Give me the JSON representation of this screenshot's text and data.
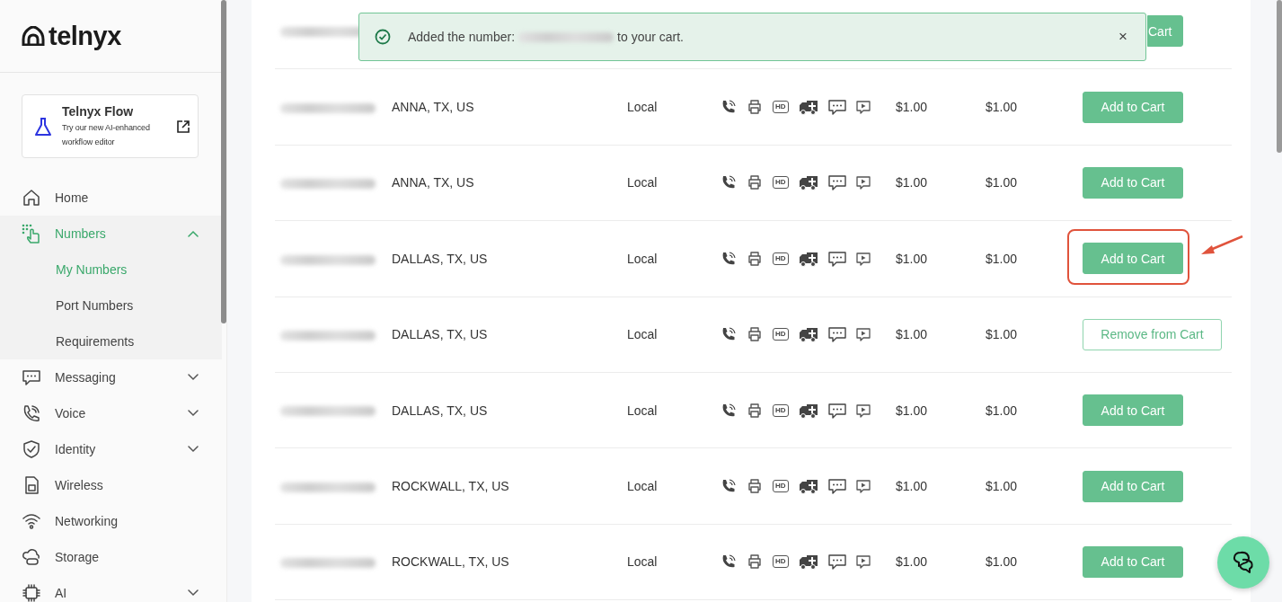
{
  "sidebar": {
    "logo": "telnyx",
    "promo": {
      "title": "Telnyx Flow",
      "text": "Try our new AI-enhanced workflow editor"
    },
    "items": [
      {
        "label": "Home",
        "kind": "link",
        "selected": false
      },
      {
        "label": "Numbers",
        "kind": "group",
        "selected": true,
        "expanded": true,
        "children": [
          {
            "label": "My Numbers",
            "selected": true
          },
          {
            "label": "Port Numbers",
            "selected": false
          },
          {
            "label": "Requirements",
            "selected": false
          }
        ]
      },
      {
        "label": "Messaging",
        "kind": "group",
        "selected": false,
        "expanded": false
      },
      {
        "label": "Voice",
        "kind": "group",
        "selected": false,
        "expanded": false
      },
      {
        "label": "Identity",
        "kind": "group",
        "selected": false,
        "expanded": false
      },
      {
        "label": "Wireless",
        "kind": "link",
        "selected": false
      },
      {
        "label": "Networking",
        "kind": "link",
        "selected": false
      },
      {
        "label": "Storage",
        "kind": "link",
        "selected": false
      },
      {
        "label": "AI",
        "kind": "group",
        "selected": false,
        "expanded": false
      }
    ]
  },
  "toast": {
    "kind": "success",
    "message_before": "Added the number:",
    "number": {
      "kind": "blurred"
    },
    "message_after": "to your cart.",
    "close": "×"
  },
  "table": {
    "rows": [
      {
        "kind": "cut",
        "number": {
          "kind": "blurred"
        },
        "action": {
          "kind": "add",
          "label": "Cart"
        },
        "highlighted": false
      },
      {
        "kind": "full",
        "number": {
          "kind": "blurred"
        },
        "location": "ANNA, TX, US",
        "type": "Local",
        "hd_label": "HD",
        "price_1": "$1.00",
        "price_2": "$1.00",
        "action": {
          "kind": "add",
          "label": "Add to Cart"
        },
        "highlighted": false
      },
      {
        "kind": "full",
        "number": {
          "kind": "blurred"
        },
        "location": "ANNA, TX, US",
        "type": "Local",
        "hd_label": "HD",
        "price_1": "$1.00",
        "price_2": "$1.00",
        "action": {
          "kind": "add",
          "label": "Add to Cart"
        },
        "highlighted": false
      },
      {
        "kind": "full",
        "number": {
          "kind": "blurred"
        },
        "location": "DALLAS, TX, US",
        "type": "Local",
        "hd_label": "HD",
        "price_1": "$1.00",
        "price_2": "$1.00",
        "action": {
          "kind": "add",
          "label": "Add to Cart"
        },
        "highlighted": true
      },
      {
        "kind": "full",
        "number": {
          "kind": "blurred"
        },
        "location": "DALLAS, TX, US",
        "type": "Local",
        "hd_label": "HD",
        "price_1": "$1.00",
        "price_2": "$1.00",
        "action": {
          "kind": "remove",
          "label": "Remove from Cart"
        },
        "highlighted": false
      },
      {
        "kind": "full",
        "number": {
          "kind": "blurred"
        },
        "location": "DALLAS, TX, US",
        "type": "Local",
        "hd_label": "HD",
        "price_1": "$1.00",
        "price_2": "$1.00",
        "action": {
          "kind": "add",
          "label": "Add to Cart"
        },
        "highlighted": false
      },
      {
        "kind": "full",
        "number": {
          "kind": "blurred"
        },
        "location": "ROCKWALL, TX, US",
        "type": "Local",
        "hd_label": "HD",
        "price_1": "$1.00",
        "price_2": "$1.00",
        "action": {
          "kind": "add",
          "label": "Add to Cart"
        },
        "highlighted": false
      },
      {
        "kind": "full",
        "number": {
          "kind": "blurred"
        },
        "location": "ROCKWALL, TX, US",
        "type": "Local",
        "hd_label": "HD",
        "price_1": "$1.00",
        "price_2": "$1.00",
        "action": {
          "kind": "add",
          "label": "Add to Cart"
        },
        "highlighted": false
      }
    ]
  }
}
